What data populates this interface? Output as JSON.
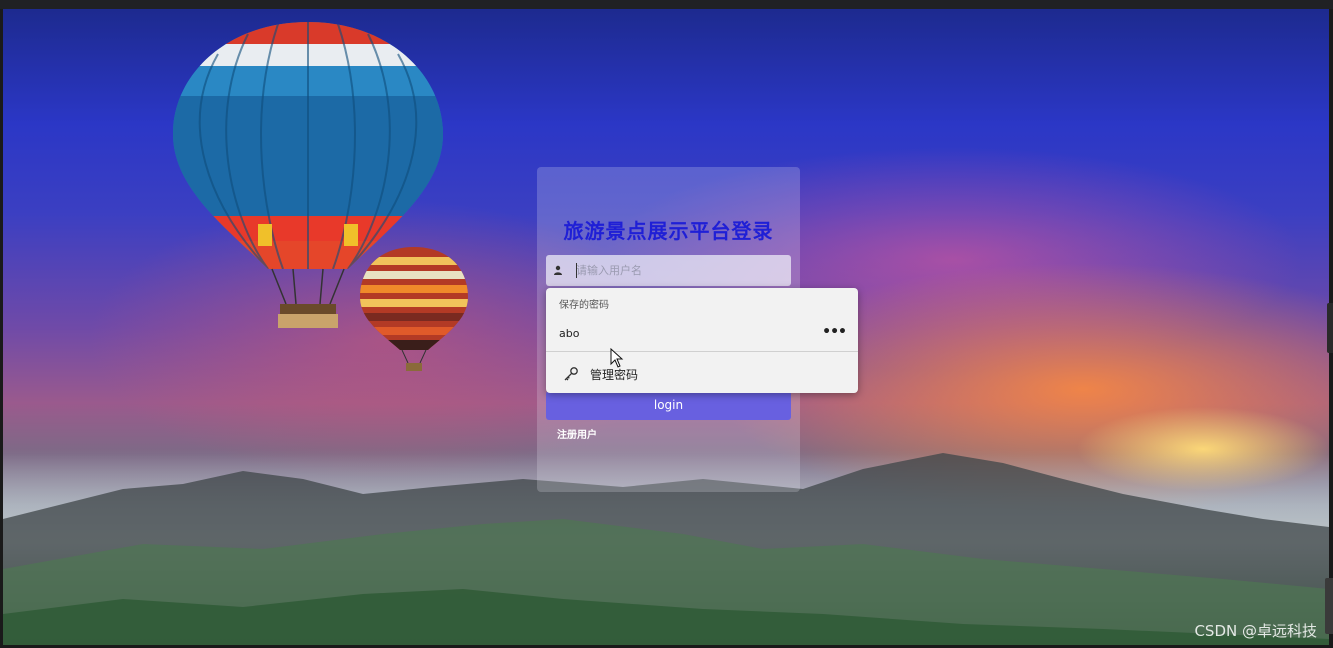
{
  "login": {
    "title": "旅游景点展示平台登录",
    "username_placeholder": "请输入用户名",
    "login_button": "login",
    "register_link": "注册用户"
  },
  "password_popup": {
    "header": "保存的密码",
    "saved_user": "abo",
    "more_icon": "•••",
    "manage_label": "管理密码"
  },
  "watermark": "CSDN @卓远科技",
  "colors": {
    "title": "#1f1fd6",
    "login_button": "#6860e0"
  }
}
